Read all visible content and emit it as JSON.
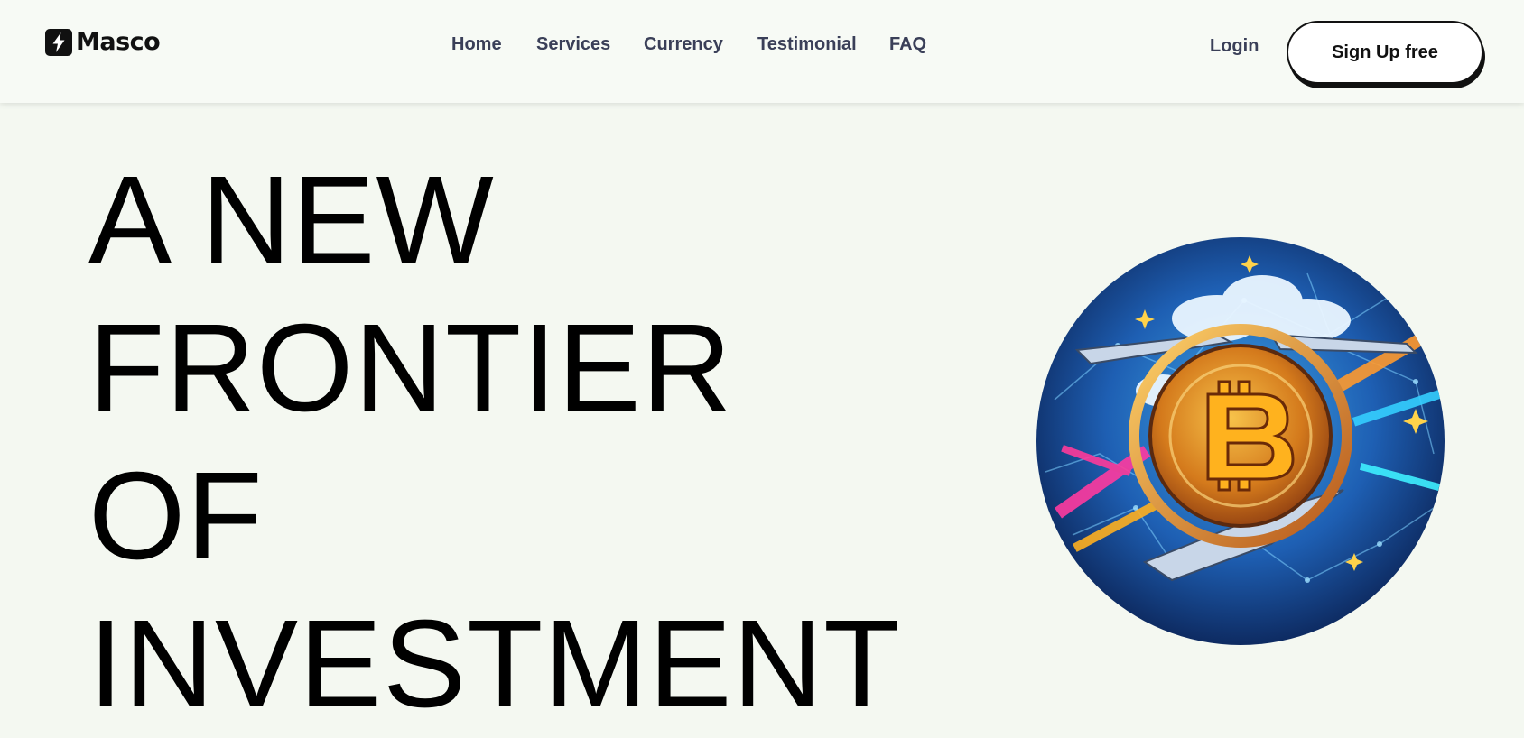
{
  "header": {
    "logo": {
      "text": "Masco",
      "icon": "lightning-bolt-icon"
    },
    "nav": [
      {
        "label": "Home"
      },
      {
        "label": "Services"
      },
      {
        "label": "Currency"
      },
      {
        "label": "Testimonial"
      },
      {
        "label": "FAQ"
      }
    ],
    "login_label": "Login",
    "signup_label": "Sign Up free"
  },
  "hero": {
    "title_lines": [
      "A NEW",
      "FRONTIER",
      "OF",
      "INVESTMENT"
    ],
    "image": {
      "subject": "bitcoin-coin-illustration",
      "symbol": "B"
    }
  },
  "colors": {
    "page_background": "#f4f8f1",
    "header_background": "#f7faf5",
    "nav_text": "#3a3f58",
    "title_text": "#000000",
    "button_border": "#111111"
  }
}
